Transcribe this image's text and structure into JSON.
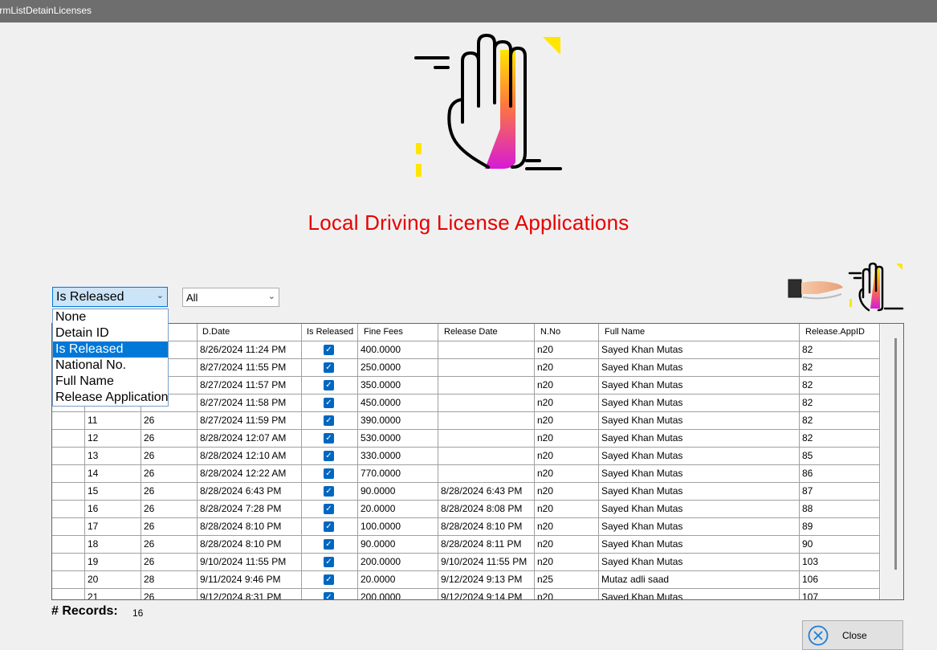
{
  "window": {
    "title": "frmListDetainLicenses"
  },
  "page": {
    "heading": "Local Driving License Applications"
  },
  "filter": {
    "selected": "Is Released",
    "options": [
      "None",
      "Detain ID",
      "Is Released",
      "National No.",
      "Full Name",
      "Release Application"
    ],
    "value_selected": "All"
  },
  "grid": {
    "columns": [
      "D.Date",
      "Is Released",
      "Fine Fees",
      "Release Date",
      "N.No",
      "Full Name",
      "Release.AppID"
    ],
    "rows": [
      {
        "detain_id": "",
        "license_id": "",
        "date": "8/26/2024 11:24 PM",
        "released": true,
        "fees": "400.0000",
        "release_date": "",
        "nno": "n20",
        "name": "Sayed Khan  Mutas",
        "app_id": "82"
      },
      {
        "detain_id": "",
        "license_id": "",
        "date": "8/27/2024 11:55 PM",
        "released": true,
        "fees": "250.0000",
        "release_date": "",
        "nno": "n20",
        "name": "Sayed Khan  Mutas",
        "app_id": "82"
      },
      {
        "detain_id": "",
        "license_id": "",
        "date": "8/27/2024 11:57 PM",
        "released": true,
        "fees": "350.0000",
        "release_date": "",
        "nno": "n20",
        "name": "Sayed Khan  Mutas",
        "app_id": "82"
      },
      {
        "detain_id": "",
        "license_id": "",
        "date": "8/27/2024 11:58 PM",
        "released": true,
        "fees": "450.0000",
        "release_date": "",
        "nno": "n20",
        "name": "Sayed Khan  Mutas",
        "app_id": "82"
      },
      {
        "detain_id": "11",
        "license_id": "26",
        "date": "8/27/2024 11:59 PM",
        "released": true,
        "fees": "390.0000",
        "release_date": "",
        "nno": "n20",
        "name": "Sayed Khan  Mutas",
        "app_id": "82"
      },
      {
        "detain_id": "12",
        "license_id": "26",
        "date": "8/28/2024 12:07 AM",
        "released": true,
        "fees": "530.0000",
        "release_date": "",
        "nno": "n20",
        "name": "Sayed Khan  Mutas",
        "app_id": "82"
      },
      {
        "detain_id": "13",
        "license_id": "26",
        "date": "8/28/2024 12:10 AM",
        "released": true,
        "fees": "330.0000",
        "release_date": "",
        "nno": "n20",
        "name": "Sayed Khan  Mutas",
        "app_id": "85"
      },
      {
        "detain_id": "14",
        "license_id": "26",
        "date": "8/28/2024 12:22 AM",
        "released": true,
        "fees": "770.0000",
        "release_date": "",
        "nno": "n20",
        "name": "Sayed Khan  Mutas",
        "app_id": "86"
      },
      {
        "detain_id": "15",
        "license_id": "26",
        "date": "8/28/2024 6:43 PM",
        "released": true,
        "fees": "90.0000",
        "release_date": "8/28/2024 6:43 PM",
        "nno": "n20",
        "name": "Sayed Khan  Mutas",
        "app_id": "87"
      },
      {
        "detain_id": "16",
        "license_id": "26",
        "date": "8/28/2024 7:28 PM",
        "released": true,
        "fees": "20.0000",
        "release_date": "8/28/2024 8:08 PM",
        "nno": "n20",
        "name": "Sayed Khan  Mutas",
        "app_id": "88"
      },
      {
        "detain_id": "17",
        "license_id": "26",
        "date": "8/28/2024 8:10 PM",
        "released": true,
        "fees": "100.0000",
        "release_date": "8/28/2024 8:10 PM",
        "nno": "n20",
        "name": "Sayed Khan  Mutas",
        "app_id": "89"
      },
      {
        "detain_id": "18",
        "license_id": "26",
        "date": "8/28/2024 8:10 PM",
        "released": true,
        "fees": "90.0000",
        "release_date": "8/28/2024 8:11 PM",
        "nno": "n20",
        "name": "Sayed Khan  Mutas",
        "app_id": "90"
      },
      {
        "detain_id": "19",
        "license_id": "26",
        "date": "9/10/2024 11:55 PM",
        "released": true,
        "fees": "200.0000",
        "release_date": "9/10/2024 11:55 PM",
        "nno": "n20",
        "name": "Sayed Khan  Mutas",
        "app_id": "103"
      },
      {
        "detain_id": "20",
        "license_id": "28",
        "date": "9/11/2024 9:46 PM",
        "released": true,
        "fees": "20.0000",
        "release_date": "9/12/2024 9:13 PM",
        "nno": "n25",
        "name": "Mutaz adli  saad",
        "app_id": "106"
      },
      {
        "detain_id": "21",
        "license_id": "26",
        "date": "9/12/2024 8:31 PM",
        "released": true,
        "fees": "200.0000",
        "release_date": "9/12/2024 9:14 PM",
        "nno": "n20",
        "name": "Sayed Khan  Mutas",
        "app_id": "107"
      }
    ]
  },
  "footer": {
    "records_label": "# Records:",
    "records_count": "16",
    "close_label": "Close"
  },
  "colors": {
    "heading": "#e60000",
    "accent": "#0078d7",
    "check": "#0067c0",
    "icon_yellow": "#ffe600",
    "icon_magenta": "#d61ad6"
  },
  "icons": {
    "hero": "detain-hand-icon",
    "release": "release-hand-icon",
    "close": "close-circle-icon"
  }
}
